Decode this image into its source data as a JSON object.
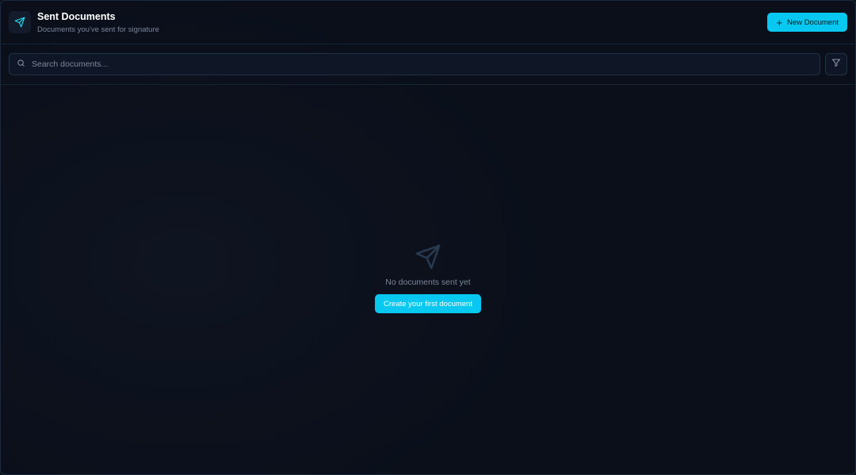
{
  "header": {
    "title": "Sent Documents",
    "subtitle": "Documents you've sent for signature",
    "logo_icon": "send-icon",
    "new_button_label": "New Document"
  },
  "search": {
    "placeholder": "Search documents...",
    "value": "",
    "icon": "search-icon",
    "filter_icon": "filter-icon"
  },
  "empty_state": {
    "icon": "send-icon",
    "message": "No documents sent yet",
    "cta_label": "Create your first document"
  },
  "colors": {
    "background": "#0a0f1a",
    "accent": "#06c8f0",
    "muted_text": "#7a8698",
    "border": "#1e3246"
  }
}
